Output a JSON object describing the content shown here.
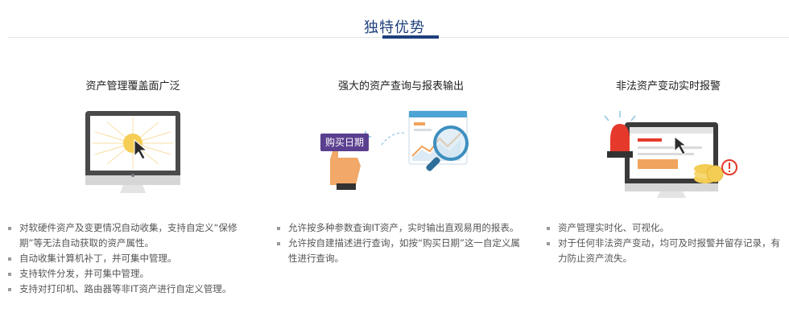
{
  "section": {
    "title": "独特优势"
  },
  "features": [
    {
      "title": "资产管理覆盖面广泛",
      "illustration": "monitor-cursor-click-icon",
      "items": [
        "对软硬件资产及变更情况自动收集，支持自定义“保修期”等无法自动获取的资产属性。",
        "自动收集计算机补丁，并可集中管理。",
        "支持软件分发，并可集中管理。",
        "支持对打印机、路由器等非IT资产进行自定义管理。"
      ]
    },
    {
      "title": "强大的资产查询与报表输出",
      "illustration": "report-search-icon",
      "badge": "购买日期",
      "items": [
        "允许按多种参数查询IT资产，实时输出直观易用的报表。",
        "允许按自建描述进行查询，如按“购买日期”这一自定义属性进行查询。"
      ]
    },
    {
      "title": "非法资产变动实时报警",
      "illustration": "alarm-monitor-icon",
      "items": [
        "资产管理实时化、可视化。",
        "对于任何非法资产变动，均可及时报警并留存记录，有力防止资产流失。"
      ]
    }
  ],
  "colors": {
    "accent": "#1e3f7c",
    "purple_badge": "#5b3f8f",
    "orange": "#f0a35c",
    "alarm_red": "#e53a2b"
  }
}
